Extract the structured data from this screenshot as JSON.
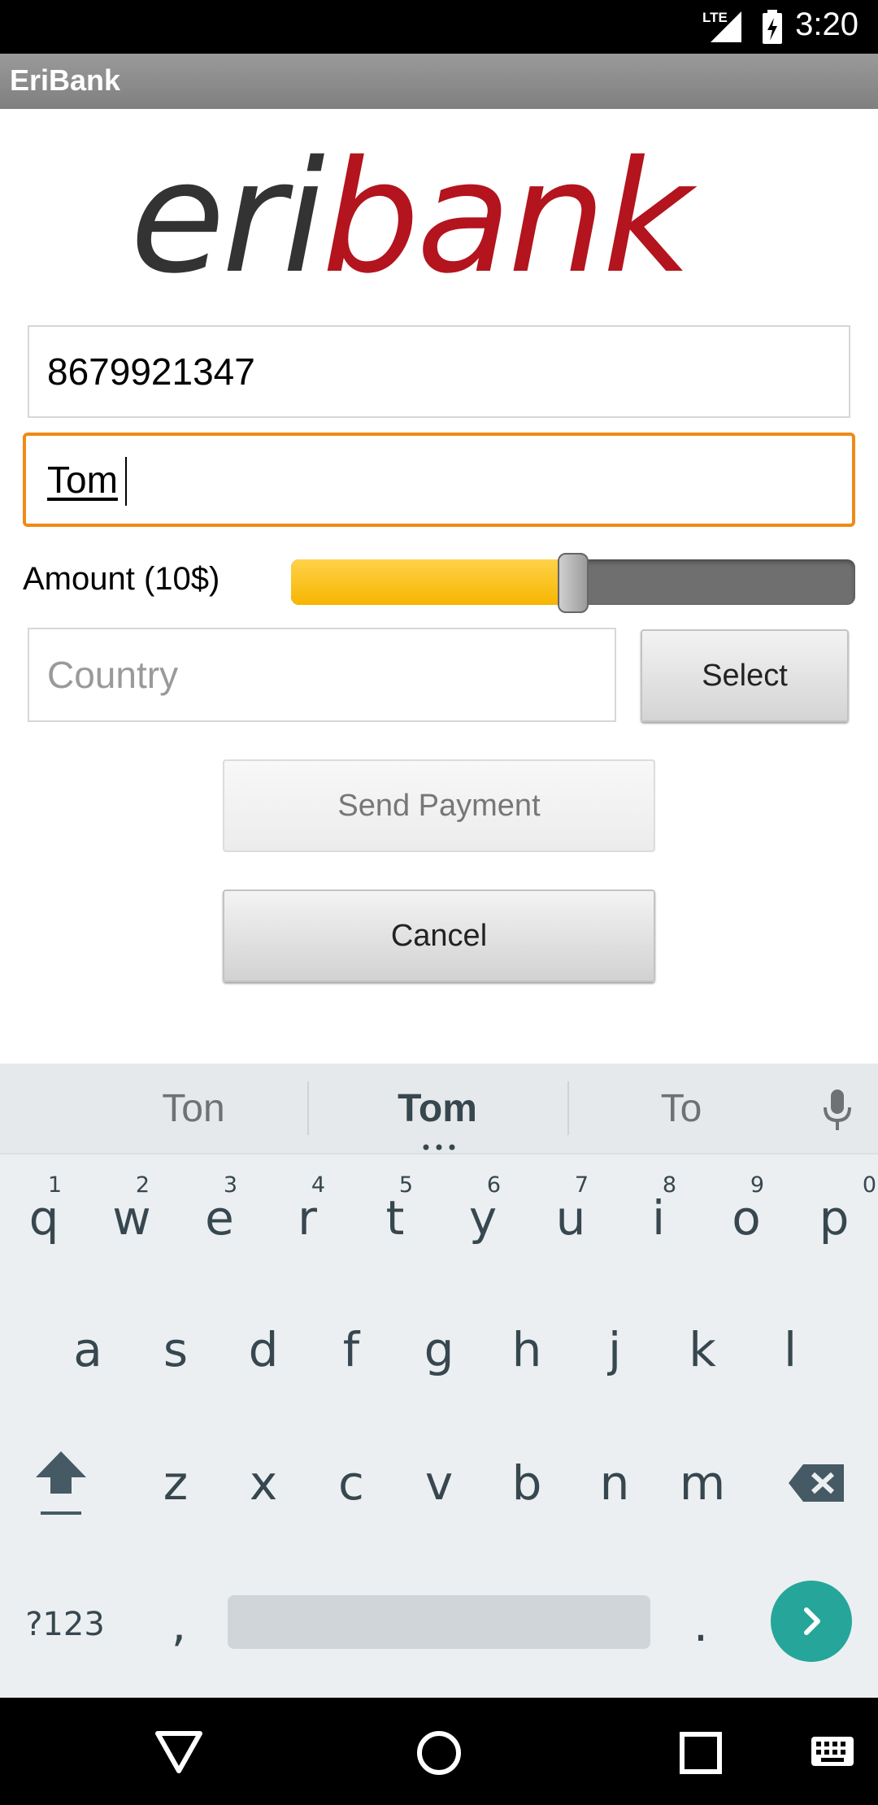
{
  "status_bar": {
    "time": "3:20",
    "network_label": "LTE"
  },
  "action_bar": {
    "title": "EriBank"
  },
  "logo": {
    "text_dark": "eri",
    "text_red": "bank",
    "color_dark": "#333333",
    "color_red": "#b3141e"
  },
  "form": {
    "phone_value": "8679921347",
    "name_value": "Tom",
    "amount_label": "Amount (10$)",
    "amount_slider_fraction": 0.5,
    "country_placeholder": "Country",
    "select_label": "Select",
    "send_label": "Send Payment",
    "cancel_label": "Cancel"
  },
  "keyboard": {
    "suggestions": [
      "Ton",
      "Tom",
      "To"
    ],
    "row1": [
      "q",
      "w",
      "e",
      "r",
      "t",
      "y",
      "u",
      "i",
      "o",
      "p"
    ],
    "row1_hints": [
      "1",
      "2",
      "3",
      "4",
      "5",
      "6",
      "7",
      "8",
      "9",
      "0"
    ],
    "row2": [
      "a",
      "s",
      "d",
      "f",
      "g",
      "h",
      "j",
      "k",
      "l"
    ],
    "row3": [
      "z",
      "x",
      "c",
      "v",
      "b",
      "n",
      "m"
    ],
    "symbols_label": "?123",
    "comma_label": ",",
    "period_label": "."
  },
  "colors": {
    "accent_focus": "#f08a17",
    "slider_fill": "#f7b500",
    "keyboard_enter": "#26a69a"
  }
}
